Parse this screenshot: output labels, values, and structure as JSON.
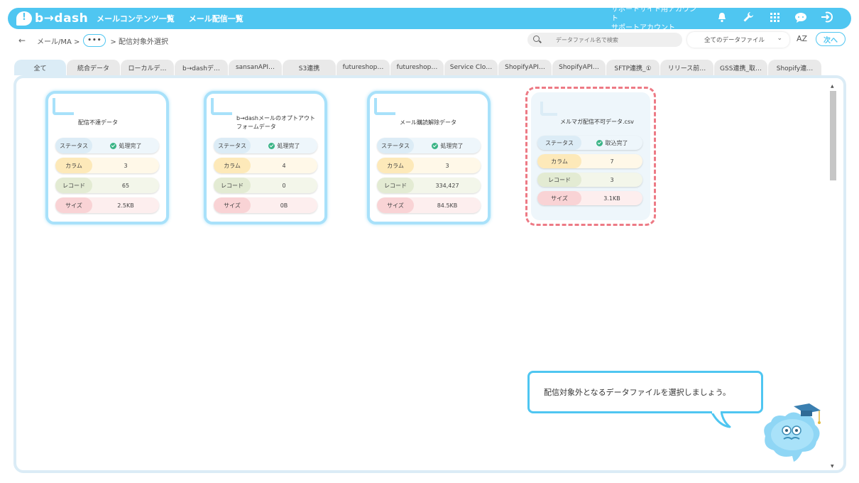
{
  "header": {
    "logo": "b→dash",
    "nav": [
      "メールコンテンツ一覧",
      "メール配信一覧"
    ],
    "account_line1": "サポートサイト用アカウント",
    "account_line2": "サポートアカウント",
    "icons": [
      "bell-icon",
      "wrench-icon",
      "grid-icon",
      "chat-icon",
      "logout-icon"
    ]
  },
  "subbar": {
    "crumb1": "メール/MA >",
    "dots": "•••",
    "crumb2": "> 配信対象外選択",
    "search_placeholder": "データファイル名で検索",
    "select_value": "全てのデータファイル",
    "sort_label": "AZ",
    "next_label": "次へ"
  },
  "tabs": [
    "全て",
    "統合データ",
    "ローカルデ…",
    "b→dashデ…",
    "sansanAPI…",
    "S3連携",
    "futureshop…",
    "futureshop…",
    "Service Clo…",
    "ShopifyAPI…",
    "ShopifyAPI…",
    "SFTP連携_①",
    "リリース前…",
    "GSS連携_取…",
    "Shopify連…"
  ],
  "cards": [
    {
      "title": "配信不達データ",
      "status_label": "ステータス",
      "status_value": "処理完了",
      "col_label": "カラム",
      "col_value": "3",
      "rec_label": "レコード",
      "rec_value": "65",
      "size_label": "サイズ",
      "size_value": "2.5KB"
    },
    {
      "title": "b→dashメールのオプトアウトフォームデータ",
      "status_label": "ステータス",
      "status_value": "処理完了",
      "col_label": "カラム",
      "col_value": "4",
      "rec_label": "レコード",
      "rec_value": "0",
      "size_label": "サイズ",
      "size_value": "0B"
    },
    {
      "title": "メール購読解除データ",
      "status_label": "ステータス",
      "status_value": "処理完了",
      "col_label": "カラム",
      "col_value": "3",
      "rec_label": "レコード",
      "rec_value": "334,427",
      "size_label": "サイズ",
      "size_value": "84.5KB"
    },
    {
      "title": "メルマガ配信不可データ.csv",
      "status_label": "ステータス",
      "status_value": "取込完了",
      "col_label": "カラム",
      "col_value": "7",
      "rec_label": "レコード",
      "rec_value": "3",
      "size_label": "サイズ",
      "size_value": "3.1KB"
    }
  ],
  "bubble": {
    "text": "配信対象外となるデータファイルを選択しましょう。"
  },
  "colors": {
    "brand": "#4fc6f1",
    "selected_border": "#ed7a85",
    "status_ok": "#3ab486"
  }
}
